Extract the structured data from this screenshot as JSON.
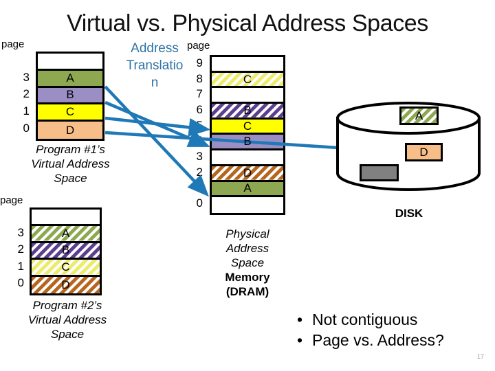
{
  "title": "Virtual vs. Physical Address Spaces",
  "translation_label": "Address Translatio n",
  "translation_lines": [
    "Address",
    "Translatio",
    "n"
  ],
  "accent_blue": "#2E74A8",
  "colors": {
    "A": "#8DA851",
    "B": "#9B8EC4",
    "C": "#FFFF00",
    "D": "#F8BE8A",
    "empty": "#FFFFFF",
    "gray_block": "#808080",
    "border": "#000000"
  },
  "program1": {
    "page_label": "page",
    "caption": [
      "Program #1’s",
      "Virtual Address",
      "Space"
    ],
    "rows": [
      {
        "index": "",
        "label": "",
        "fill": "empty",
        "hatched": false
      },
      {
        "index": "3",
        "label": "A",
        "fill": "A",
        "hatched": false
      },
      {
        "index": "2",
        "label": "B",
        "fill": "B",
        "hatched": false
      },
      {
        "index": "1",
        "label": "C",
        "fill": "C",
        "hatched": false
      },
      {
        "index": "0",
        "label": "D",
        "fill": "D",
        "hatched": false
      }
    ]
  },
  "program2": {
    "page_label": "page",
    "caption": [
      "Program #2’s",
      "Virtual Address",
      "Space"
    ],
    "rows": [
      {
        "index": "",
        "label": "",
        "fill": "empty",
        "hatched": false
      },
      {
        "index": "3",
        "label": "A",
        "fill": "A",
        "hatched": true
      },
      {
        "index": "2",
        "label": "B",
        "fill": "B",
        "hatched": true
      },
      {
        "index": "1",
        "label": "C",
        "fill": "C",
        "hatched": true
      },
      {
        "index": "0",
        "label": "D",
        "fill": "D",
        "hatched": true
      }
    ]
  },
  "physical": {
    "page_label": "page",
    "caption_italic": [
      "Physical",
      "Address",
      "Space"
    ],
    "caption_bold": [
      "Memory",
      "(DRAM)"
    ],
    "rows": [
      {
        "index": "9",
        "label": "",
        "fill": "empty",
        "hatched": false
      },
      {
        "index": "8",
        "label": "C",
        "fill": "C",
        "hatched": true
      },
      {
        "index": "7",
        "label": "",
        "fill": "empty",
        "hatched": false
      },
      {
        "index": "6",
        "label": "B",
        "fill": "B",
        "hatched": true
      },
      {
        "index": "5",
        "label": "C",
        "fill": "C",
        "hatched": false
      },
      {
        "index": "4",
        "label": "B",
        "fill": "B",
        "hatched": false
      },
      {
        "index": "3",
        "label": "",
        "fill": "empty",
        "hatched": false
      },
      {
        "index": "2",
        "label": "D",
        "fill": "D",
        "hatched": true
      },
      {
        "index": "1",
        "label": "A",
        "fill": "A",
        "hatched": false
      },
      {
        "index": "0",
        "label": "",
        "fill": "empty",
        "hatched": false
      }
    ]
  },
  "disk": {
    "caption": "DISK",
    "blocks": [
      {
        "label": "A",
        "fill": "A",
        "hatched": true
      },
      {
        "label": "D",
        "fill": "D",
        "hatched": false
      },
      {
        "label": "",
        "fill": "gray_block",
        "hatched": false
      }
    ]
  },
  "mappings": [
    {
      "from": "program1.page3.A",
      "to": "physical.page1"
    },
    {
      "from": "program1.page2.B",
      "to": "physical.page4"
    },
    {
      "from": "program1.page1.C",
      "to": "physical.page5"
    },
    {
      "from": "program1.page0.D",
      "to": "disk.D"
    }
  ],
  "bullets": [
    "Not contiguous",
    "Page vs. Address?"
  ],
  "slide_number": "17"
}
